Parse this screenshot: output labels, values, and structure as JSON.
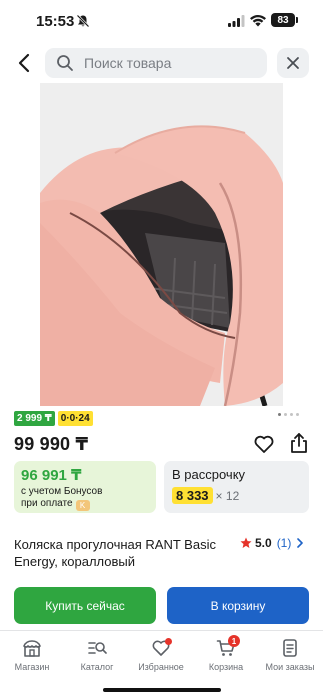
{
  "status_bar": {
    "time": "15:53",
    "battery": "83",
    "icons": [
      "bell-off-icon",
      "signal-icon",
      "wifi-icon",
      "battery-icon"
    ]
  },
  "header": {
    "search_placeholder": "Поиск товара",
    "icons": [
      "back-arrow-icon",
      "search-icon",
      "close-icon"
    ]
  },
  "gallery": {
    "total_images": 4,
    "active_index": 0
  },
  "badges": {
    "credit": "2 999 ₸",
    "installment": "0·0·24"
  },
  "price": "99 990 ₸",
  "bonus": {
    "price": "96 991 ₸",
    "note_line1": "с учетом Бонусов",
    "note_line2": "при оплате",
    "mark": "K"
  },
  "installment": {
    "title": "В рассрочку",
    "amount": "8 333",
    "months": "× 12"
  },
  "product": {
    "title": "Коляска прогулочная RANT Basic Energy, коралловый",
    "rating": "5.0",
    "reviews": "(1)"
  },
  "actions": {
    "buy_now": "Купить сейчас",
    "add_to_cart": "В корзину"
  },
  "tab_bar": {
    "items": [
      {
        "label": "Магазин",
        "icon": "store-icon"
      },
      {
        "label": "Каталог",
        "icon": "catalog-search-icon"
      },
      {
        "label": "Избранное",
        "icon": "heart-icon"
      },
      {
        "label": "Корзина",
        "icon": "cart-icon",
        "badge": "1"
      },
      {
        "label": "Мои заказы",
        "icon": "orders-icon"
      }
    ]
  },
  "colors": {
    "green": "#2fa640",
    "blue": "#1e63c7",
    "yellow": "#ffe033",
    "red": "#e5332a",
    "product_pink": "#f0b5aa"
  }
}
